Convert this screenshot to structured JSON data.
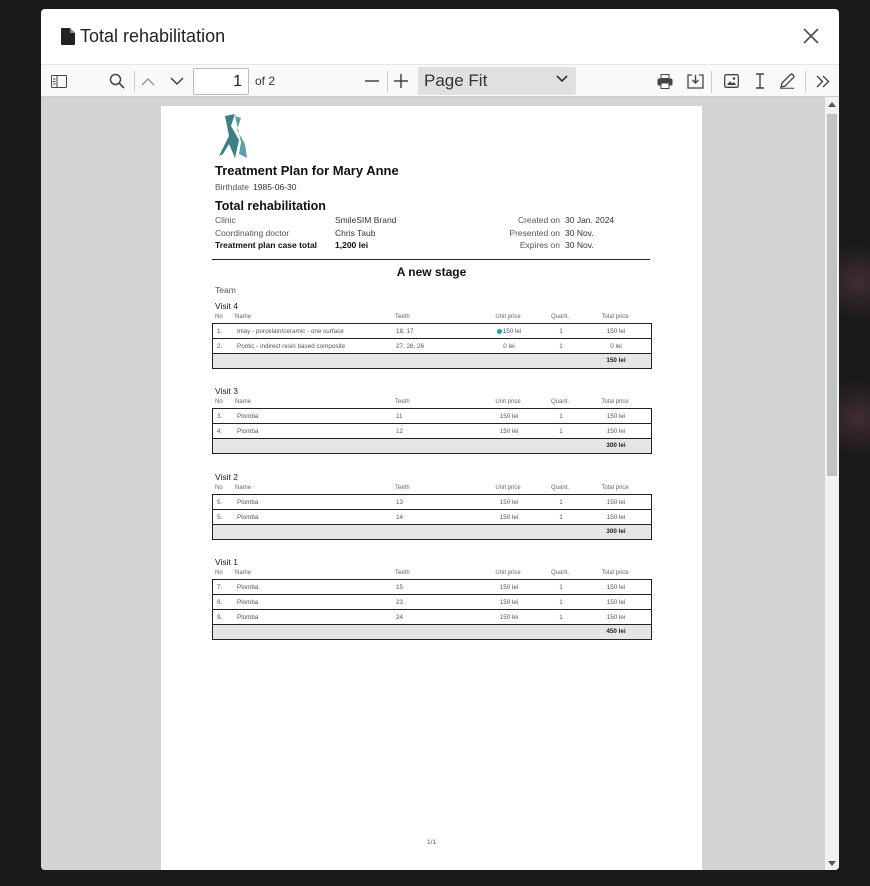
{
  "modal": {
    "title": "Total rehabilitation"
  },
  "toolbar": {
    "page_current": "1",
    "page_of": "of 2",
    "zoom_value": "Page Fit"
  },
  "document": {
    "title": "Treatment Plan for Mary Anne",
    "birthdate_label": "Birthdate",
    "birthdate_value": "1985-06-30",
    "subtitle": "Total rehabilitation",
    "clinic_label": "Clinic",
    "clinic_value": "SmileSIM Brand",
    "doctor_label": "Coordinating doctor",
    "doctor_value": "Chris Taub",
    "total_label": "Treatment plan case total",
    "total_value": "1,200 lei",
    "created_label": "Created on",
    "created_value": "30 Jan. 2024",
    "presented_label": "Presented on",
    "presented_value": "30 Nov.",
    "expires_label": "Expires on",
    "expires_value": "30 Nov.",
    "stage_title": "A new stage",
    "team_label": "Team",
    "columns": {
      "no": "No",
      "name": "Name",
      "teeth": "Teeth",
      "unit": "Unit price",
      "qty": "Quant.",
      "total": "Total price"
    },
    "visits": [
      {
        "title": "Visit 4",
        "rows": [
          {
            "no": "1.",
            "name": "Inlay - porcelain/ceramic - one surface",
            "teeth": "18, 17",
            "unit": "150 lei",
            "qty": "1",
            "total": "150 lei"
          },
          {
            "no": "2.",
            "name": "Pontic - indirect resin based composite",
            "teeth": "27, 28, 26",
            "unit": "0 lei",
            "qty": "1",
            "total": "0 lei"
          }
        ],
        "total": "150 lei"
      },
      {
        "title": "Visit 3",
        "rows": [
          {
            "no": "3.",
            "name": "Plomba",
            "teeth": "11",
            "unit": "150 lei",
            "qty": "1",
            "total": "150 lei"
          },
          {
            "no": "4.",
            "name": "Plomba",
            "teeth": "12",
            "unit": "150 lei",
            "qty": "1",
            "total": "150 lei"
          }
        ],
        "total": "300 lei"
      },
      {
        "title": "Visit 2",
        "rows": [
          {
            "no": "5.",
            "name": "Plomba",
            "teeth": "13",
            "unit": "150 lei",
            "qty": "1",
            "total": "150 lei"
          },
          {
            "no": "5.",
            "name": "Plomba",
            "teeth": "14",
            "unit": "150 lei",
            "qty": "1",
            "total": "150 lei"
          }
        ],
        "total": "300 lei"
      },
      {
        "title": "Visit 1",
        "rows": [
          {
            "no": "7.",
            "name": "Plomba",
            "teeth": "15",
            "unit": "150 lei",
            "qty": "1",
            "total": "150 lei"
          },
          {
            "no": "8.",
            "name": "Plomba",
            "teeth": "23",
            "unit": "150 lei",
            "qty": "1",
            "total": "150 lei"
          },
          {
            "no": "9.",
            "name": "Plomba",
            "teeth": "24",
            "unit": "150 lei",
            "qty": "1",
            "total": "150 lei"
          }
        ],
        "total": "450 lei"
      }
    ],
    "page_footer": "1/1"
  },
  "colors": {
    "accent": "#1aa3a3",
    "logo": "#3d7f86"
  },
  "icons": [
    "document-icon",
    "close-icon",
    "sidebar-toggle-icon",
    "search-icon",
    "chevron-up-icon",
    "chevron-down-icon",
    "minus-icon",
    "plus-icon",
    "print-icon",
    "download-icon",
    "image-icon",
    "text-cursor-icon",
    "pen-icon",
    "double-chevron-right-icon"
  ]
}
